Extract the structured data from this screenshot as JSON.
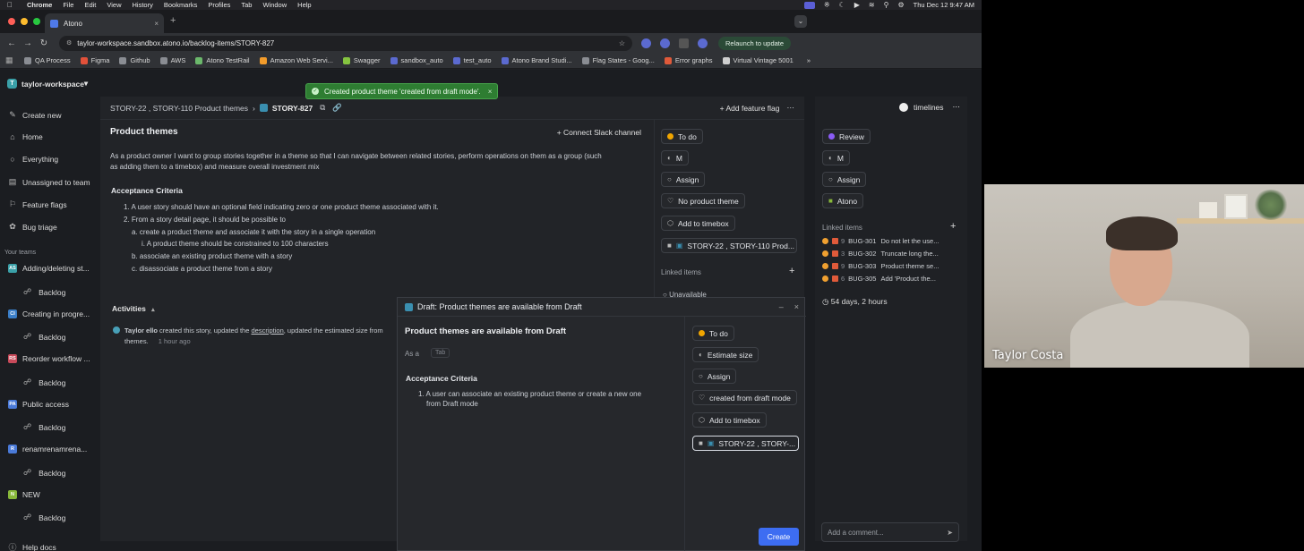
{
  "menubar": {
    "items": [
      "Chrome",
      "File",
      "Edit",
      "View",
      "History",
      "Bookmarks",
      "Profiles",
      "Tab",
      "Window",
      "Help"
    ],
    "clock": "Thu Dec 12  9:47 AM"
  },
  "browser": {
    "tab_title": "Atono",
    "url": "taylor-workspace.sandbox.atono.io/backlog-items/STORY-827",
    "relaunch_label": "Relaunch to update",
    "bookmarks": [
      {
        "label": "QA Process",
        "color": "#8a8d93"
      },
      {
        "label": "Figma",
        "color": "#e2513a"
      },
      {
        "label": "Github",
        "color": "#8a8d93"
      },
      {
        "label": "AWS",
        "color": "#8a8d93"
      },
      {
        "label": "Atono TestRail",
        "color": "#6bb86b"
      },
      {
        "label": "Amazon Web Servi...",
        "color": "#f39c2b"
      },
      {
        "label": "Swagger",
        "color": "#85c440"
      },
      {
        "label": "sandbox_auto",
        "color": "#5b6ad0"
      },
      {
        "label": "test_auto",
        "color": "#5b6ad0"
      },
      {
        "label": "Atono Brand Studi...",
        "color": "#5b6ad0"
      },
      {
        "label": "Flag States - Goog...",
        "color": "#8a8d93"
      },
      {
        "label": "Error graphs",
        "color": "#e05a3a"
      },
      {
        "label": "Virtual Vintage 5001",
        "color": "#cfcfcf"
      }
    ]
  },
  "sidebar": {
    "workspace": "taylor-workspace",
    "items": [
      {
        "label": "Create new",
        "icon": "compose-icon"
      },
      {
        "label": "Home",
        "icon": "home-icon"
      },
      {
        "label": "Everything",
        "icon": "circle-icon"
      },
      {
        "label": "Unassigned to team",
        "icon": "inbox-icon"
      },
      {
        "label": "Feature flags",
        "icon": "flag-icon"
      },
      {
        "label": "Bug triage",
        "icon": "bug-icon"
      }
    ],
    "teams_label": "Your teams",
    "teams": [
      {
        "label": "Adding/deleting st...",
        "abbr": "AS",
        "color": "#3aa0a8",
        "backlog": "Backlog"
      },
      {
        "label": "Creating in progre...",
        "abbr": "CI",
        "color": "#3a7ec8",
        "backlog": "Backlog"
      },
      {
        "label": "Reorder workflow ...",
        "abbr": "RS",
        "color": "#c84a5a",
        "backlog": "Backlog"
      },
      {
        "label": "Public access",
        "abbr": "PA",
        "color": "#4a7ad8",
        "backlog": "Backlog"
      },
      {
        "label": "renamrenamrena...",
        "abbr": "R",
        "color": "#4a7ad8",
        "backlog": "Backlog"
      },
      {
        "label": "NEW",
        "abbr": "N",
        "color": "#88b83a",
        "backlog": "Backlog"
      }
    ],
    "help": "Help docs"
  },
  "topbar": {
    "breadcrumb": "STORY-22 , STORY-110 Product themes",
    "story_id": "STORY-827",
    "add_feature_flag": "Add feature flag"
  },
  "toast": {
    "text": "Created product theme 'created from draft mode'."
  },
  "story": {
    "title": "Product themes",
    "connect_slack": "Connect Slack channel",
    "desc_1": "As a product owner I want to group stories together in a theme so that I can navigate between related stories, perform operations on them as a group (such",
    "desc_2": "as adding them to a timebox) and measure overall investment mix",
    "ac_title": "Acceptance Criteria",
    "ac": [
      "1. A user story should have an optional field indicating zero or one product theme associated with it.",
      "2. From a story detail page, it should be possible to",
      "a. create a product theme and associate it with the story in a single operation",
      "i. A product theme should be constrained to 100 characters",
      "b. associate an existing product theme with a story",
      "c. disassociate a product theme from a story"
    ]
  },
  "props": {
    "status": "To do",
    "status_color": "#f0a500",
    "size": "M",
    "assign": "Assign",
    "theme": "No product theme",
    "timebox": "Add to timebox",
    "parent": "STORY-22 , STORY-110 Prod...",
    "linked_label": "Linked items",
    "unavailable": "Unavailable"
  },
  "activities": {
    "title": "Activities",
    "line1_prefix": "Taylor ello",
    "line1_text": " created this story, updated the ",
    "line1_link": "description",
    "line1_rest": ", updated the estimated size from",
    "line2": "themes.",
    "line2_time": "1 hour ago"
  },
  "right_panel": {
    "timelines": "timelines",
    "status": "Review",
    "status_color": "#8b5cf6",
    "size": "M",
    "assign": "Assign",
    "team": "Atono",
    "linked_label": "Linked items",
    "linked": [
      {
        "num": "9",
        "id": "BUG-301",
        "title": "Do not let the use..."
      },
      {
        "num": "3",
        "id": "BUG-302",
        "title": "Truncate long the..."
      },
      {
        "num": "9",
        "id": "BUG-303",
        "title": "Product theme se..."
      },
      {
        "num": "6",
        "id": "BUG-305",
        "title": "Add 'Product the..."
      }
    ],
    "elapsed": "54 days, 2 hours",
    "comment_placeholder": "Add a comment..."
  },
  "modal": {
    "header": "Draft: Product themes are available from Draft",
    "title": "Product themes are available from Draft",
    "as_a": "As a",
    "tab_hint": "Tab",
    "ac_title": "Acceptance Criteria",
    "ac_1": "1. A user can associate an existing product theme or create a new one",
    "ac_2": "from Draft mode",
    "status": "To do",
    "estimate": "Estimate size",
    "assign": "Assign",
    "theme": "created from draft mode",
    "timebox": "Add to timebox",
    "parent": "STORY-22 , STORY-...",
    "create": "Create"
  },
  "video": {
    "name": "Taylor Costa"
  }
}
